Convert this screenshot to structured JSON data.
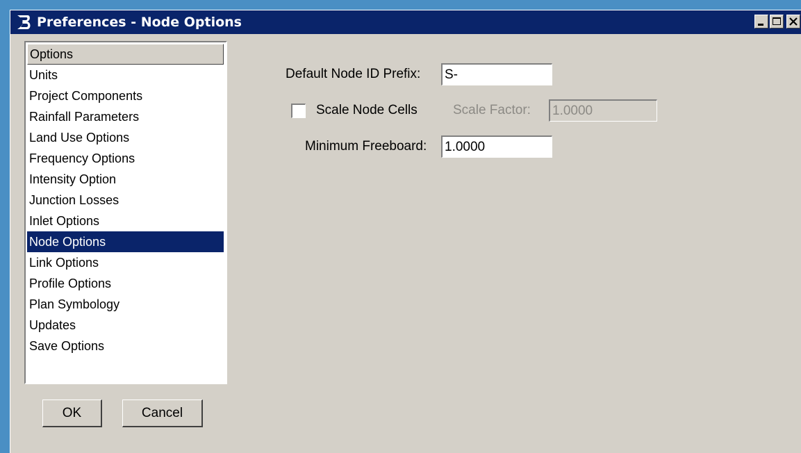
{
  "window": {
    "title": "Preferences - Node Options",
    "icon": "bentley-b-icon",
    "controls": [
      "minimize-icon",
      "maximize-icon",
      "close-icon"
    ]
  },
  "options_list": {
    "header": "Options",
    "selected": "Node Options",
    "items": [
      {
        "label": "Units"
      },
      {
        "label": "Project Components"
      },
      {
        "label": "Rainfall Parameters"
      },
      {
        "label": "Land Use Options"
      },
      {
        "label": "Frequency Options"
      },
      {
        "label": "Intensity Option"
      },
      {
        "label": "Junction Losses"
      },
      {
        "label": "Inlet Options"
      },
      {
        "label": "Node Options"
      },
      {
        "label": "Link Options"
      },
      {
        "label": "Profile Options"
      },
      {
        "label": "Plan Symbology"
      },
      {
        "label": "Updates"
      },
      {
        "label": "Save Options"
      }
    ]
  },
  "buttons": {
    "ok": "OK",
    "cancel": "Cancel"
  },
  "node_options": {
    "prefix_label": "Default Node ID Prefix:",
    "prefix_value": "S-",
    "scale_cells_label": "Scale Node Cells",
    "scale_cells_checked": false,
    "scale_factor_label": "Scale Factor:",
    "scale_factor_value": "1.0000",
    "freeboard_label": "Minimum Freeboard:",
    "freeboard_value": "1.0000"
  },
  "colors": {
    "titlebar": "#0a246a",
    "selection": "#0a246a",
    "dialog_face": "#d4d0c8",
    "desktop": "#4a8fc4"
  }
}
